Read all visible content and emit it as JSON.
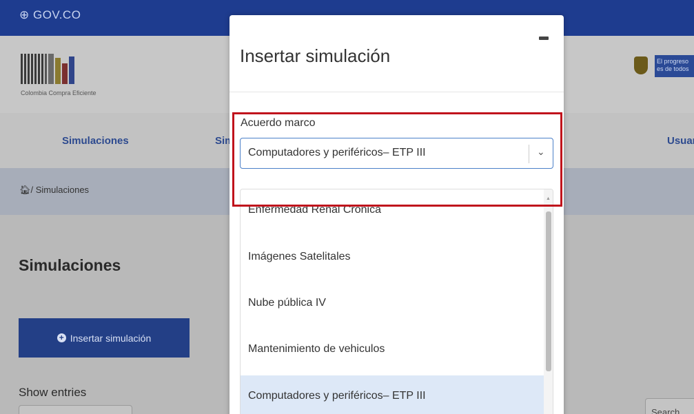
{
  "topbar": {
    "brand": "GOV.CO"
  },
  "header": {
    "logo_caption": "Colombia Compra Eficiente",
    "progress_line1": "El progreso",
    "progress_line2": "es de todos"
  },
  "nav": {
    "items": [
      "Simulaciones",
      "Sim",
      "Usuar"
    ]
  },
  "breadcrumb": {
    "text": "/ Simulaciones"
  },
  "page": {
    "title": "Simulaciones",
    "insert_button": "Insertar simulación",
    "show_entries": "Show entries",
    "search_label": "Search"
  },
  "modal": {
    "title": "Insertar simulación",
    "field_label": "Acuerdo marco",
    "selected_value": "Computadores y periféricos– ETP III",
    "options": [
      "Enfermedad Renal Crónica",
      "Imágenes Satelitales",
      "Nube pública IV",
      "Mantenimiento de vehiculos",
      "Computadores y periféricos– ETP III"
    ],
    "selected_index": 4
  },
  "colors": {
    "brand_blue": "#1e3c8f",
    "focus_blue": "#4a7fc8",
    "highlight_red": "#c0121c",
    "selected_option_bg": "#dde8f7"
  }
}
